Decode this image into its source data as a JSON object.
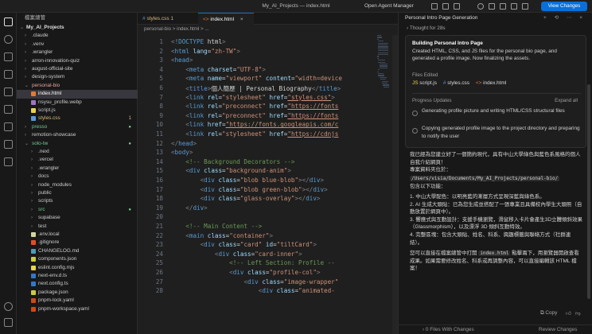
{
  "titlebar": {
    "title": "My_AI_Projects — index.html",
    "agent_manager": "Open Agent Manager",
    "view_button": "View Changes"
  },
  "explorer": {
    "header": "檔案總管",
    "root": "My_AI_Projects",
    "items": [
      {
        "label": ".claude",
        "kind": "folder",
        "depth": 1,
        "open": false
      },
      {
        "label": ".venv",
        "kind": "folder",
        "depth": 1,
        "open": false
      },
      {
        "label": ".wrangler",
        "kind": "folder",
        "depth": 1,
        "open": false
      },
      {
        "label": "arron-innovation-quiz",
        "kind": "folder",
        "depth": 1,
        "open": false
      },
      {
        "label": "august-official-site",
        "kind": "folder",
        "depth": 1,
        "open": false
      },
      {
        "label": "design-system",
        "kind": "folder",
        "depth": 1,
        "open": false
      },
      {
        "label": "personal-bio",
        "kind": "folder",
        "depth": 1,
        "open": true,
        "color": "#e8a3a3"
      },
      {
        "label": "index.html",
        "kind": "html",
        "depth": 2,
        "selected": true
      },
      {
        "label": "nsysu_profile.webp",
        "kind": "img",
        "depth": 2
      },
      {
        "label": "script.js",
        "kind": "js",
        "depth": 2
      },
      {
        "label": "styles.css",
        "kind": "css",
        "depth": 2,
        "badge": "1",
        "color": "#d7ba7d"
      },
      {
        "label": "presso",
        "kind": "folder",
        "depth": 1,
        "open": false,
        "color": "#73c991",
        "dot": true
      },
      {
        "label": "remotion-showcase",
        "kind": "folder",
        "depth": 1,
        "open": false
      },
      {
        "label": "solo-tw",
        "kind": "folder",
        "depth": 1,
        "open": true,
        "color": "#73c991",
        "dot": true
      },
      {
        "label": ".next",
        "kind": "folder",
        "depth": 2,
        "open": false
      },
      {
        "label": ".vercel",
        "kind": "folder",
        "depth": 2,
        "open": false
      },
      {
        "label": ".wrangler",
        "kind": "folder",
        "depth": 2,
        "open": false
      },
      {
        "label": "docs",
        "kind": "folder",
        "depth": 2,
        "open": false
      },
      {
        "label": "node_modules",
        "kind": "folder",
        "depth": 2,
        "open": false
      },
      {
        "label": "public",
        "kind": "folder",
        "depth": 2,
        "open": false
      },
      {
        "label": "scripts",
        "kind": "folder",
        "depth": 2,
        "open": false
      },
      {
        "label": "src",
        "kind": "folder",
        "depth": 2,
        "open": false,
        "color": "#73c991",
        "dot": true
      },
      {
        "label": "supabase",
        "kind": "folder",
        "depth": 2,
        "open": false
      },
      {
        "label": "test",
        "kind": "folder",
        "depth": 2,
        "open": false
      },
      {
        "label": ".env.local",
        "kind": "env",
        "depth": 2
      },
      {
        "label": ".gitignore",
        "kind": "git",
        "depth": 2
      },
      {
        "label": "CHANGELOG.md",
        "kind": "md",
        "depth": 2
      },
      {
        "label": "components.json",
        "kind": "json",
        "depth": 2
      },
      {
        "label": "eslint.config.mjs",
        "kind": "js",
        "depth": 2
      },
      {
        "label": "next-env.d.ts",
        "kind": "ts",
        "depth": 2
      },
      {
        "label": "next.config.ts",
        "kind": "ts",
        "depth": 2
      },
      {
        "label": "package.json",
        "kind": "json",
        "depth": 2
      },
      {
        "label": "pnpm-lock.yaml",
        "kind": "yaml",
        "depth": 2
      },
      {
        "label": "pnpm-workspace.yaml",
        "kind": "yaml",
        "depth": 2
      }
    ]
  },
  "editor": {
    "tabs": [
      {
        "label": "styles.css 1",
        "active": false
      },
      {
        "label": "index.html",
        "active": true
      }
    ],
    "breadcrumb": "personal-bio > index.html > ...",
    "lines": [
      "<!DOCTYPE html>",
      "<html lang=\"zh-TW\">",
      "<head>",
      "    <meta charset=\"UTF-8\">",
      "    <meta name=\"viewport\" content=\"width=device",
      "    <title>個人簡歷 | Personal Biography</title>",
      "    <link rel=\"stylesheet\" href=\"styles.css\">",
      "    <link rel=\"preconnect\" href=\"https://fonts",
      "    <link rel=\"preconnect\" href=\"https://fonts",
      "    <link href=\"https://fonts.googleapis.com/c",
      "    <link rel=\"stylesheet\" href=\"https://cdnjs",
      "</head>",
      "<body>",
      "    <!-- Background Decorators -->",
      "    <div class=\"background-anim\">",
      "        <div class=\"blob blue-blob\"></div>",
      "        <div class=\"blob green-blob\"></div>",
      "        <div class=\"glass-overlay\"></div>",
      "    </div>",
      "",
      "    <!-- Main Content -->",
      "    <main class=\"container\">",
      "        <div class=\"card\" id=\"tiltCard\">",
      "            <div class=\"card-inner\">",
      "                <!-- Left Section: Profile --",
      "                <div class=\"profile-col\">",
      "                    <div class=\"image-wrapper\"",
      "                        <div class=\"animated-"
    ]
  },
  "chat": {
    "title": "Personal Intro Page Generation",
    "thought": "Thought for 28s",
    "task_title": "Building Personal Intro Page",
    "task_body": "Created HTML, CSS, and JS files for the personal bio page, and generated a profile image. Now finalizing the assets.",
    "files_edited_label": "Files Edited",
    "files": [
      "script.js",
      "styles.css",
      "index.html"
    ],
    "progress_label": "Progress Updates",
    "expand_all": "Expand all",
    "steps": [
      "Generating profile picture and writing HTML/CSS structural files",
      "Copying generated profile image to the project directory and preparing to notify the user"
    ],
    "message_intro": "我已經為您建立好了一個簡約現代，具有中山大學綠色與藍色系風格的個人自我介紹網頁！",
    "message_location_label": "專案資料夾位於：",
    "message_path": "/Users/visia/Documents/My_AI_Projects/personal-bio/",
    "message_contains": "包含以下功能：",
    "message_points": [
      "1. 中山大學配色：以明亮藍的漸層方式呈現深藍與綠色系。",
      "2. AI 生成大頭貼：已為您生成並搭配了一張專業且具備校內學生大頭照（自動放置於網頁中）。",
      "3. 響應式與互動設計：支援手機瀏覽，滑鼠移入卡片會產生3D立體傾斜效果（Glassmorphism），以及漂浮 3D 傾斜互動特效。",
      "4. 完整區塊：包含大頭貼、姓名、科系、興趣標籤與聯絡方式（社群連結）。"
    ],
    "message_outro_a": "您可以直接在檔案總管中打開",
    "message_outro_chip": "index.html",
    "message_outro_b": "點擊兩下，用瀏覽器開啟查看成果。如果需要修改姓名、科系或再調整內容，可以直接編輯該 HTML 檔案！",
    "copy_label": "Copy",
    "bottom_files": "0 Files With Changes",
    "review": "Review Changes"
  }
}
